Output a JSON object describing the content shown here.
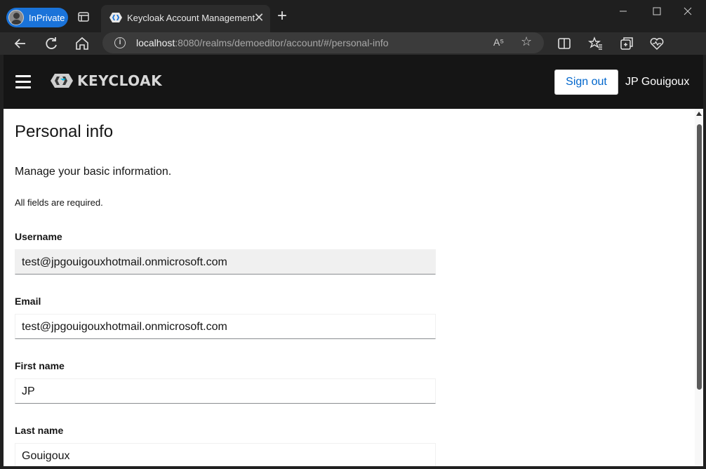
{
  "browser": {
    "inprivate_label": "InPrivate",
    "tab_title": "Keycloak Account Management",
    "tab_close": "✕",
    "new_tab": "+",
    "url_host": "localhost",
    "url_rest": ":8080/realms/demoeditor/account/#/personal-info",
    "read_aloud": "A⁵"
  },
  "header": {
    "logo_text": "KEYCLOAK",
    "sign_out_label": "Sign out",
    "user_name": "JP Gouigoux"
  },
  "page": {
    "title": "Personal info",
    "subtitle": "Manage your basic information.",
    "required_note": "All fields are required.",
    "fields": {
      "username": {
        "label": "Username",
        "value": "test@jpgouigouxhotmail.onmicrosoft.com"
      },
      "email": {
        "label": "Email",
        "value": "test@jpgouigouxhotmail.onmicrosoft.com"
      },
      "first_name": {
        "label": "First name",
        "value": "JP"
      },
      "last_name": {
        "label": "Last name",
        "value": "Gouigoux"
      }
    }
  },
  "colors": {
    "accent": "#0066cc",
    "inprivate": "#1a73d9",
    "masthead": "#151515"
  }
}
